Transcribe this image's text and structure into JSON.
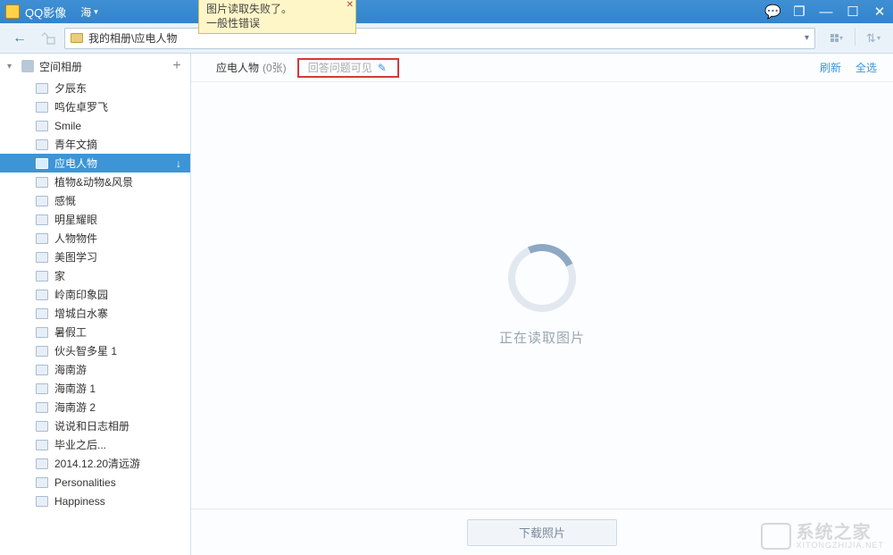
{
  "titlebar": {
    "app_title": "QQ影像",
    "user_name": "海"
  },
  "tooltip": {
    "line1": "图片读取失败了。",
    "line2": "一般性错误"
  },
  "navbar": {
    "path": "我的相册\\应电人物"
  },
  "sidebar": {
    "root_label": "空间相册",
    "items": [
      {
        "label": "夕辰东"
      },
      {
        "label": "鸣佐卓罗飞"
      },
      {
        "label": "Smile"
      },
      {
        "label": "青年文摘"
      },
      {
        "label": "应电人物",
        "selected": true
      },
      {
        "label": "植物&动物&风景"
      },
      {
        "label": "感慨"
      },
      {
        "label": "明星耀眼"
      },
      {
        "label": "人物物件"
      },
      {
        "label": "美图学习"
      },
      {
        "label": "家"
      },
      {
        "label": "岭南印象园"
      },
      {
        "label": "增城白水寨"
      },
      {
        "label": "暑假工"
      },
      {
        "label": "伙头智多星 1"
      },
      {
        "label": "海南游"
      },
      {
        "label": "海南游 1"
      },
      {
        "label": "海南游 2"
      },
      {
        "label": "说说和日志相册"
      },
      {
        "label": "毕业之后..."
      },
      {
        "label": "2014.12.20清远游"
      },
      {
        "label": "Personalities"
      },
      {
        "label": "Happiness"
      }
    ]
  },
  "main": {
    "album_title": "应电人物",
    "album_count": "(0张)",
    "visibility": "回答问题可见",
    "link_refresh": "刷新",
    "link_selectall": "全选",
    "loading_text": "正在读取图片",
    "download_btn": "下载照片"
  },
  "watermark": {
    "big": "系统之家",
    "small": "XITONGZHIJIA.NET"
  }
}
